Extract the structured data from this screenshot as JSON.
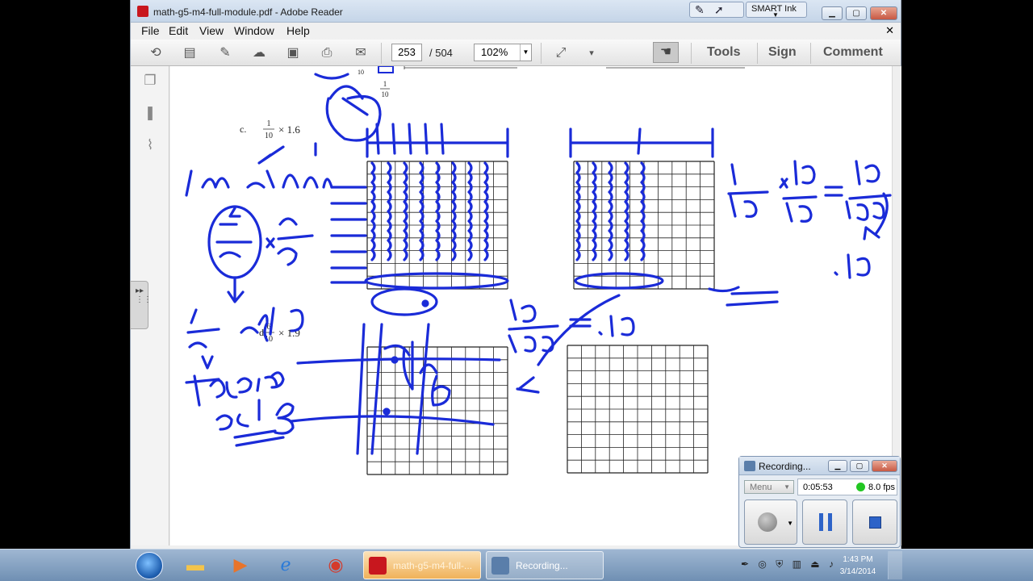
{
  "window": {
    "title": "math-g5-m4-full-module.pdf - Adobe Reader",
    "smart_ink": "SMART Ink"
  },
  "menu": [
    "File",
    "Edit",
    "View",
    "Window",
    "Help"
  ],
  "toolbar": {
    "page_current": "253",
    "page_total": "/ 504",
    "zoom": "102%",
    "tools_label": "Tools",
    "sign_label": "Sign",
    "comment_label": "Comment"
  },
  "document": {
    "fraction_top_num": "1",
    "fraction_top_den": "10",
    "problem_c_label": "c.",
    "problem_c_num": "1",
    "problem_c_den": "10",
    "problem_c_expr": "× 1.6",
    "problem_d_label": "d.",
    "problem_d_num": "6",
    "problem_d_den": "10",
    "problem_d_expr": "× 1.9",
    "corner_small": "10"
  },
  "recorder": {
    "title": "Recording...",
    "menu_label": "Menu",
    "elapsed": "0:05:53",
    "fps": "8.0 fps"
  },
  "taskbar": {
    "pdf_task": "math-g5-m4-full-...",
    "rec_task": "Recording...",
    "time": "1:43 PM",
    "date": "3/14/2014"
  },
  "colors": {
    "ink": "#1a2bd8",
    "grid": "#222222",
    "title_gradient": "#c5d5e8"
  }
}
